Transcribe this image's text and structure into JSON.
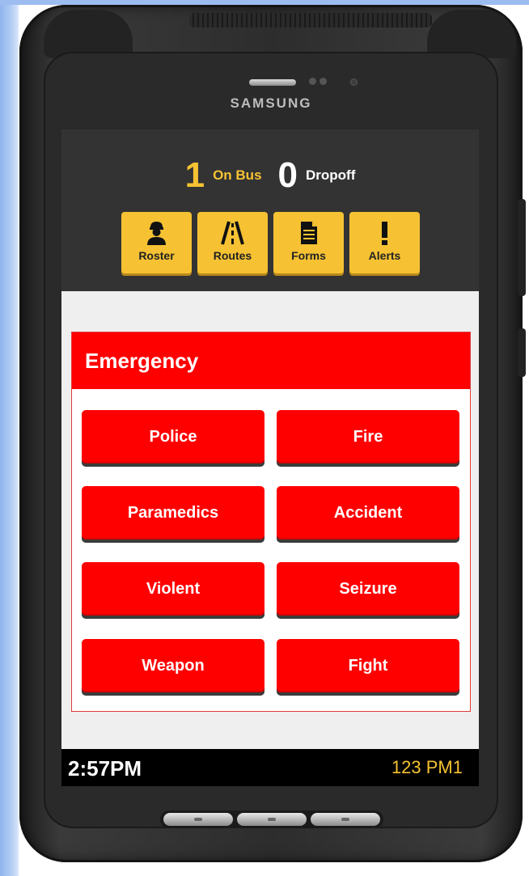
{
  "device": {
    "brand": "SAMSUNG"
  },
  "header": {
    "on_bus_count": "1",
    "on_bus_label": "On Bus",
    "dropoff_count": "0",
    "dropoff_label": "Dropoff"
  },
  "nav": {
    "items": [
      {
        "label": "Roster",
        "icon": "person-icon"
      },
      {
        "label": "Routes",
        "icon": "road-icon"
      },
      {
        "label": "Forms",
        "icon": "document-icon"
      },
      {
        "label": "Alerts",
        "icon": "exclamation-icon"
      }
    ]
  },
  "emergency": {
    "title": "Emergency",
    "buttons": [
      "Police",
      "Fire",
      "Paramedics",
      "Accident",
      "Violent",
      "Seizure",
      "Weapon",
      "Fight"
    ]
  },
  "status_bar": {
    "time": "2:57PM",
    "route_id": "123 PM1"
  },
  "colors": {
    "accent_yellow": "#f6c233",
    "emergency_red": "#ff0000",
    "header_bg": "#333333",
    "status_bg": "#000000"
  }
}
